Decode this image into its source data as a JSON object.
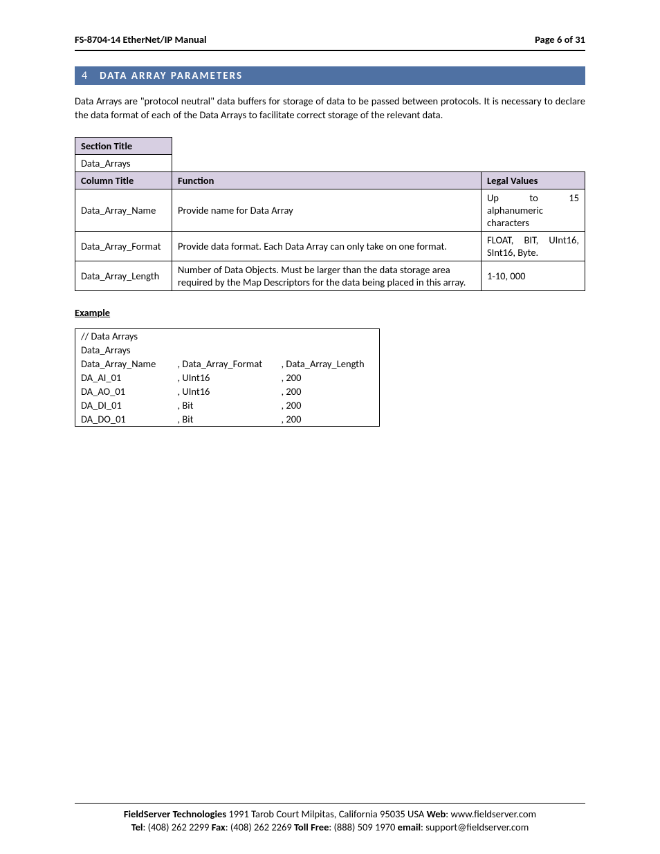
{
  "header": {
    "left": "FS-8704-14 EtherNet/IP Manual",
    "right": "Page 6 of 31"
  },
  "section": {
    "number": "4",
    "title": "DATA ARRAY PARAMETERS"
  },
  "intro": "Data Arrays are \"protocol neutral\" data buffers for storage of data to be passed between protocols.  It is necessary to declare the data format of each of the Data Arrays to facilitate correct storage of the relevant data.",
  "params": {
    "sectionTitleLabel": "Section Title",
    "sectionTitleValue": "Data_Arrays",
    "columnTitleLabel": "Column Title",
    "functionLabel": "Function",
    "legalLabel": "Legal Values",
    "rows": [
      {
        "name": "Data_Array_Name",
        "func": "Provide name for Data Array",
        "legal": "Up to 15 alphanumeric characters"
      },
      {
        "name": "Data_Array_Format",
        "func": "Provide data format. Each Data Array can only take on one format.",
        "legal": "FLOAT, BIT, UInt16, SInt16, Byte."
      },
      {
        "name": "Data_Array_Length",
        "func": "Number of Data Objects. Must be larger than the data storage area required by the Map Descriptors for the data being placed in this array.",
        "legal": "1-10, 000"
      }
    ]
  },
  "exampleLabel": "Example",
  "example": {
    "comment": "//    Data Arrays",
    "decl": "Data_Arrays",
    "headers": {
      "c1": "Data_Array_Name",
      "c2": ", Data_Array_Format",
      "c3": ", Data_Array_Length"
    },
    "rows": [
      {
        "c1": "DA_AI_01",
        "c2": ", UInt16",
        "c3": ", 200"
      },
      {
        "c1": "DA_AO_01",
        "c2": ", UInt16",
        "c3": ", 200"
      },
      {
        "c1": "DA_DI_01",
        "c2": ", Bit",
        "c3": ", 200"
      },
      {
        "c1": "DA_DO_01",
        "c2": ", Bit",
        "c3": ", 200"
      }
    ]
  },
  "footer": {
    "line1_bold1": "FieldServer Technologies",
    "line1_addr": " 1991 Tarob Court Milpitas, California 95035 USA  ",
    "line1_web_label": "Web",
    "line1_web": ": www.fieldserver.com",
    "line2_tel_label": "Tel",
    "line2_tel": ": (408) 262 2299   ",
    "line2_fax_label": "Fax",
    "line2_fax": ": (408) 262 2269   ",
    "line2_toll_label": "Toll Free",
    "line2_toll": ": (888) 509 1970   ",
    "line2_email_label": "email",
    "line2_email": ": support@fieldserver.com"
  }
}
